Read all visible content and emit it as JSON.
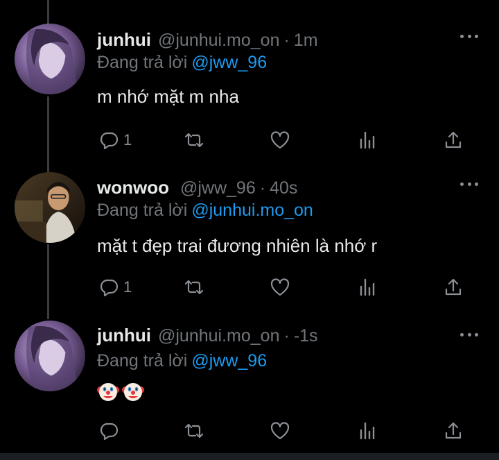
{
  "tweets": [
    {
      "name": "junhui",
      "handle": "@junhui.mo_on",
      "time": "1m",
      "reply_prefix": "Đang trả lời",
      "reply_to": "@jww_96",
      "text": "m nhớ mặt m nha",
      "reply_count": "1",
      "retweet_count": "",
      "like_count": ""
    },
    {
      "name": "wonwoo",
      "handle": "@jww_96",
      "time": "40s",
      "reply_prefix": "Đang trả lời",
      "reply_to": "@junhui.mo_on",
      "text": "mặt t đẹp trai đương nhiên là nhớ r",
      "reply_count": "1",
      "retweet_count": "",
      "like_count": ""
    },
    {
      "name": "junhui",
      "handle": "@junhui.mo_on",
      "time": "-1s",
      "reply_prefix": "Đang trả lời",
      "reply_to": "@jww_96",
      "emoji": [
        "clown-face",
        "clown-face"
      ],
      "reply_count": "",
      "retweet_count": "",
      "like_count": ""
    }
  ],
  "separator": "·",
  "colors": {
    "background": "#000000",
    "text": "#e7e9ea",
    "muted": "#71767b",
    "mention": "#1d9bf0",
    "icon": "#8b9096"
  },
  "icons": [
    "reply-icon",
    "retweet-icon",
    "like-icon",
    "views-icon",
    "share-icon",
    "more-icon"
  ]
}
